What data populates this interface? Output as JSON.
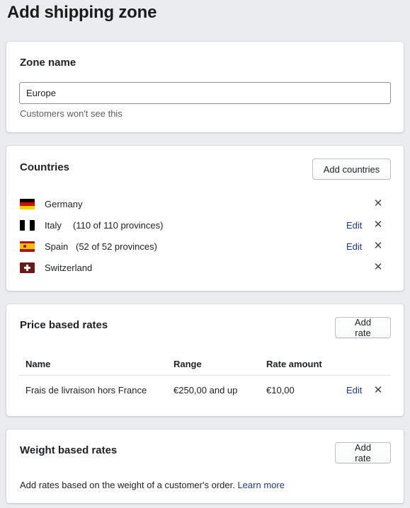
{
  "page": {
    "title": "Add shipping zone"
  },
  "zone": {
    "title": "Zone name",
    "value": "Europe",
    "help": "Customers won't see this"
  },
  "countries": {
    "title": "Countries",
    "add_label": "Add countries",
    "items": [
      {
        "name": "Germany",
        "provinces": "",
        "edit": "",
        "flag": [
          "#000000",
          "#dd0000",
          "#ffce00"
        ]
      },
      {
        "name": "Italy",
        "provinces": "(110 of 110 provinces)",
        "edit": "Edit",
        "flag": [
          "#009246",
          "#ffffff",
          "#ce2b37"
        ]
      },
      {
        "name": "Spain",
        "provinces": "(52 of 52 provinces)",
        "edit": "Edit",
        "flag": [
          "#aa151b",
          "#f1bf00",
          "#aa151b"
        ]
      },
      {
        "name": "Switzerland",
        "provinces": "",
        "edit": "",
        "flag": [
          "#d52b1e",
          "#ffffff"
        ]
      }
    ]
  },
  "price_rates": {
    "title": "Price based rates",
    "add_label": "Add rate",
    "columns": [
      "Name",
      "Range",
      "Rate amount"
    ],
    "rows": [
      {
        "name": "Frais de livraison hors France",
        "range": "€250,00 and up",
        "amount": "€10,00",
        "edit": "Edit"
      }
    ]
  },
  "weight_rates": {
    "title": "Weight based rates",
    "add_label": "Add rate",
    "description": "Add rates based on the weight of a customer's order.",
    "link": "Learn more"
  },
  "icons": {
    "remove": "close-icon"
  },
  "colors": {
    "link": "#2c6ecb",
    "background": "#ebecf0"
  }
}
